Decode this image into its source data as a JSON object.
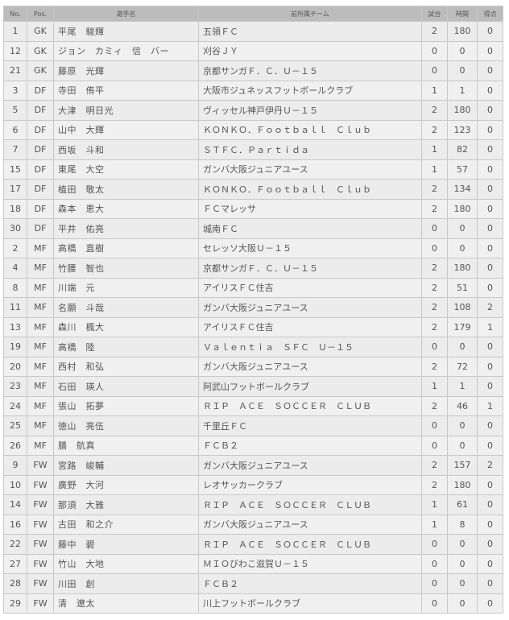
{
  "headers": {
    "no": "No.",
    "pos": "Pos.",
    "name": "選手名",
    "team": "前所属チーム",
    "games": "試合",
    "minutes": "時間",
    "goals": "得点"
  },
  "rows": [
    {
      "no": "1",
      "pos": "GK",
      "name": "平尾　駿輝",
      "team": "五領ＦＣ",
      "games": "2",
      "minutes": "180",
      "goals": "0"
    },
    {
      "no": "12",
      "pos": "GK",
      "name": "ジョン　カミィ　信　バー",
      "team": "刈谷ＪＹ",
      "games": "0",
      "minutes": "0",
      "goals": "0"
    },
    {
      "no": "21",
      "pos": "GK",
      "name": "藤原　光輝",
      "team": "京都サンガＦ．Ｃ．Ｕ－１５",
      "games": "0",
      "minutes": "0",
      "goals": "0"
    },
    {
      "no": "3",
      "pos": "DF",
      "name": "寺田　侑平",
      "team": "大阪市ジュネッスフットボールクラブ",
      "games": "1",
      "minutes": "1",
      "goals": "0"
    },
    {
      "no": "5",
      "pos": "DF",
      "name": "大津　明日光",
      "team": "ヴィッセル神戸伊丹Ｕ－１５",
      "games": "2",
      "minutes": "180",
      "goals": "0"
    },
    {
      "no": "6",
      "pos": "DF",
      "name": "山中　大輝",
      "team": "ＫＯＮＫＯ．Ｆｏｏｔｂａｌｌ　Ｃｌｕｂ",
      "games": "2",
      "minutes": "123",
      "goals": "0"
    },
    {
      "no": "7",
      "pos": "DF",
      "name": "西坂　斗和",
      "team": "ＳＴＦＣ．Ｐａｒｔｉｄａ",
      "games": "1",
      "minutes": "82",
      "goals": "0"
    },
    {
      "no": "15",
      "pos": "DF",
      "name": "東尾　大空",
      "team": "ガンバ大阪ジュニアユース",
      "games": "1",
      "minutes": "57",
      "goals": "0"
    },
    {
      "no": "17",
      "pos": "DF",
      "name": "植田　敬太",
      "team": "ＫＯＮＫＯ．Ｆｏｏｔｂａｌｌ　Ｃｌｕｂ",
      "games": "2",
      "minutes": "134",
      "goals": "0"
    },
    {
      "no": "18",
      "pos": "DF",
      "name": "森本　恵大",
      "team": "ＦＣマレッサ",
      "games": "2",
      "minutes": "180",
      "goals": "0"
    },
    {
      "no": "30",
      "pos": "DF",
      "name": "平井　佑亮",
      "team": "城南ＦＣ",
      "games": "0",
      "minutes": "0",
      "goals": "0"
    },
    {
      "no": "2",
      "pos": "MF",
      "name": "高橋　直樹",
      "team": "セレッソ大阪Ｕ－１５",
      "games": "0",
      "minutes": "0",
      "goals": "0"
    },
    {
      "no": "4",
      "pos": "MF",
      "name": "竹腰　智也",
      "team": "京都サンガＦ．Ｃ．Ｕ－１５",
      "games": "2",
      "minutes": "180",
      "goals": "0"
    },
    {
      "no": "8",
      "pos": "MF",
      "name": "川端　元",
      "team": "アイリスＦＣ住吉",
      "games": "2",
      "minutes": "51",
      "goals": "0"
    },
    {
      "no": "11",
      "pos": "MF",
      "name": "名願　斗哉",
      "team": "ガンバ大阪ジュニアユース",
      "games": "2",
      "minutes": "108",
      "goals": "2"
    },
    {
      "no": "13",
      "pos": "MF",
      "name": "森川　楓大",
      "team": "アイリスＦＣ住吉",
      "games": "2",
      "minutes": "179",
      "goals": "1"
    },
    {
      "no": "19",
      "pos": "MF",
      "name": "高橋　陸",
      "team": "Ｖａｌｅｎｔｉａ　ＳＦＣ　Ｕ－１５",
      "games": "0",
      "minutes": "0",
      "goals": "0"
    },
    {
      "no": "20",
      "pos": "MF",
      "name": "西村　和弘",
      "team": "ガンバ大阪ジュニアユース",
      "games": "2",
      "minutes": "72",
      "goals": "0"
    },
    {
      "no": "23",
      "pos": "MF",
      "name": "石田　瑛人",
      "team": "阿武山フットボールクラブ",
      "games": "1",
      "minutes": "1",
      "goals": "0"
    },
    {
      "no": "24",
      "pos": "MF",
      "name": "張山　拓夢",
      "team": "ＲＩＰ　ＡＣＥ　ＳＯＣＣＥＲ　ＣＬＵＢ",
      "games": "2",
      "minutes": "46",
      "goals": "1"
    },
    {
      "no": "25",
      "pos": "MF",
      "name": "徳山　亮伍",
      "team": "千里丘ＦＣ",
      "games": "0",
      "minutes": "0",
      "goals": "0"
    },
    {
      "no": "26",
      "pos": "MF",
      "name": "膳　航真",
      "team": "ＦＣＢ２",
      "games": "0",
      "minutes": "0",
      "goals": "0"
    },
    {
      "no": "9",
      "pos": "FW",
      "name": "宮路　峻輔",
      "team": "ガンバ大阪ジュニアユース",
      "games": "2",
      "minutes": "157",
      "goals": "2"
    },
    {
      "no": "10",
      "pos": "FW",
      "name": "廣野　大河",
      "team": "レオサッカークラブ",
      "games": "2",
      "minutes": "180",
      "goals": "0"
    },
    {
      "no": "14",
      "pos": "FW",
      "name": "那須　大雅",
      "team": "ＲＩＰ　ＡＣＥ　ＳＯＣＣＥＲ　ＣＬＵＢ",
      "games": "1",
      "minutes": "61",
      "goals": "0"
    },
    {
      "no": "16",
      "pos": "FW",
      "name": "古田　和之介",
      "team": "ガンバ大阪ジュニアユース",
      "games": "1",
      "minutes": "8",
      "goals": "0"
    },
    {
      "no": "22",
      "pos": "FW",
      "name": "藤中　碧",
      "team": "ＲＩＰ　ＡＣＥ　ＳＯＣＣＥＲ　ＣＬＵＢ",
      "games": "0",
      "minutes": "0",
      "goals": "0"
    },
    {
      "no": "27",
      "pos": "FW",
      "name": "竹山　大地",
      "team": "ＭＩＯびわこ滋賀Ｕ－１５",
      "games": "0",
      "minutes": "0",
      "goals": "0"
    },
    {
      "no": "28",
      "pos": "FW",
      "name": "川田　創",
      "team": "ＦＣＢ２",
      "games": "0",
      "minutes": "0",
      "goals": "0"
    },
    {
      "no": "29",
      "pos": "FW",
      "name": "清　遼太",
      "team": "川上フットボールクラブ",
      "games": "0",
      "minutes": "0",
      "goals": "0"
    }
  ]
}
